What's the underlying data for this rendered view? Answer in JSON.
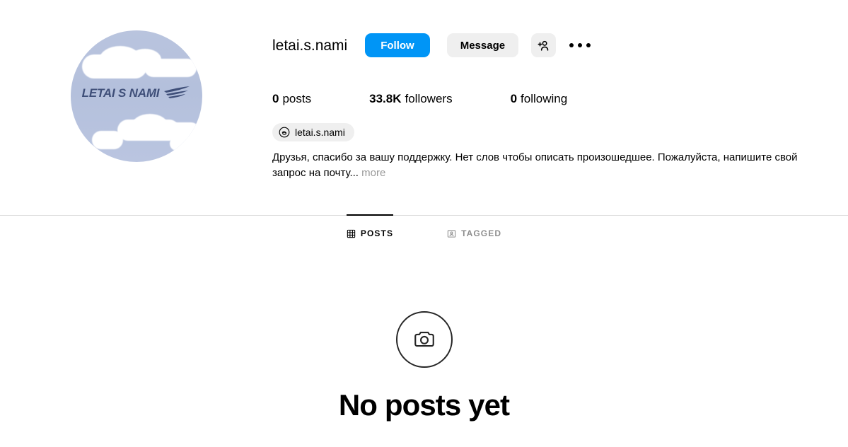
{
  "profile": {
    "username": "letai.s.nami",
    "avatar": {
      "brand_text": "LETAI S NAMI",
      "background_color": "#b6c2dd",
      "text_color": "#3f4f79"
    },
    "actions": {
      "follow_label": "Follow",
      "message_label": "Message",
      "follow_color": "#0095f6",
      "secondary_bg": "#efefef",
      "add_person_icon": "add-person-icon",
      "more_options_icon": "ellipsis-icon"
    },
    "stats": [
      {
        "key": "posts",
        "value": "0",
        "label": "posts"
      },
      {
        "key": "followers",
        "value": "33.8K",
        "label": "followers"
      },
      {
        "key": "following",
        "value": "0",
        "label": "following"
      }
    ],
    "threads_badge": {
      "icon": "threads-icon",
      "handle": "letai.s.nami"
    },
    "bio": {
      "text": "Друзья, спасибо за вашу поддержку. Нет слов чтобы описать произошедшее. Пожалуйста, напишите свой запрос на почту...",
      "more_label": "more"
    }
  },
  "tabs": [
    {
      "id": "posts",
      "label": "POSTS",
      "icon": "grid-icon",
      "active": true
    },
    {
      "id": "tagged",
      "label": "TAGGED",
      "icon": "tagged-person-icon",
      "active": false
    }
  ],
  "empty_state": {
    "icon": "camera-icon",
    "title": "No posts yet"
  }
}
